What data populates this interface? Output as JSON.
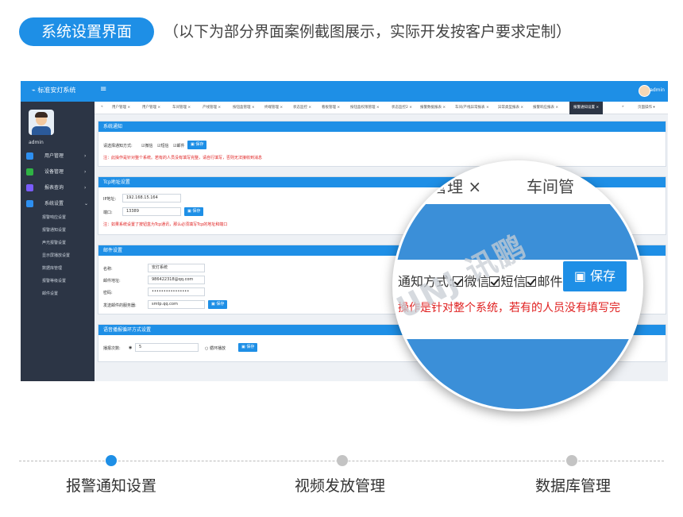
{
  "header": {
    "title": "系统设置界面",
    "subtitle": "（以下为部分界面案例截图展示，实际开发按客户要求定制）"
  },
  "app": {
    "brand": "标准安灯系统",
    "user": "admin",
    "sidebar_user": "admin",
    "nav": [
      {
        "label": "用户管理",
        "icon": "user-icon",
        "color": "#2d8ff0"
      },
      {
        "label": "设备管理",
        "icon": "wrench-icon",
        "color": "#2fb344"
      },
      {
        "label": "报表查询",
        "icon": "report-icon",
        "color": "#7a5cff"
      },
      {
        "label": "系统设置",
        "icon": "gear-icon",
        "color": "#2d8ff0"
      }
    ],
    "sub_nav": [
      "报警响应设置",
      "报警通知设置",
      "声光报警设置",
      "显示屏播放设置",
      "数据库管理",
      "报警等级设置",
      "邮件设置"
    ],
    "tabs": [
      "用户管理 ×",
      "用户管理 ×",
      "车间管理 ×",
      "产线管理 ×",
      "按钮盒管理 ×",
      "终端管理 ×",
      "状态监控 ×",
      "看板管理 ×",
      "按钮盒权限管理 ×",
      "状态监控2 ×",
      "报警数据报表 ×",
      "车间/产线异常报表 ×",
      "异常类型报表 ×",
      "报警响应报表 ×"
    ],
    "active_tab": "报警通知设置 ×",
    "tab_more": "页面操作 ▾",
    "notify": {
      "header": "系统通知",
      "method_label": "请选择通知方式:",
      "options": [
        "微信",
        "短信",
        "邮件"
      ],
      "save": "保存",
      "warning": "注：此操作是针对整个系统。若有的人员没有填写完整，请自行填写，否则无法接收到消息"
    },
    "tcp": {
      "header": "Tcp地址设置",
      "ip_label": "IP地址:",
      "ip_value": "192.168.15.164",
      "port_label": "端口:",
      "port_value": "13389",
      "save": "保存",
      "warning": "注：如果系统设置了按钮盒为Tcp通讯，那么必须填写Tcp的地址和端口"
    },
    "mail": {
      "header": "邮件设置",
      "name_label": "名称:",
      "name_value": "安灯系统",
      "addr_label": "邮件地址:",
      "addr_value": "986422318@qq.com",
      "pwd_label": "密码:",
      "pwd_value": "••••••••••••••••",
      "server_label": "发送邮件的服务器:",
      "server_value": "smtp.qq.com",
      "save": "保存"
    },
    "voice": {
      "header": "语音播报循环方式设置",
      "count_label": "播报次数:",
      "count_value": "5",
      "loop_label": "循环播放",
      "save": "保存"
    }
  },
  "magnifier": {
    "tab_left": "管理 ×",
    "tab_right": "车间管",
    "method": "通知方式:",
    "options": [
      "微信",
      "短信",
      "邮件"
    ],
    "save": "保存",
    "warning": "操作是针对整个系统，若有的人员没有填写完",
    "watermark": "SUNJ 讯鹏"
  },
  "timeline": [
    {
      "label": "报警通知设置",
      "active": true
    },
    {
      "label": "视频发放管理",
      "active": false
    },
    {
      "label": "数据库管理",
      "active": false
    }
  ]
}
